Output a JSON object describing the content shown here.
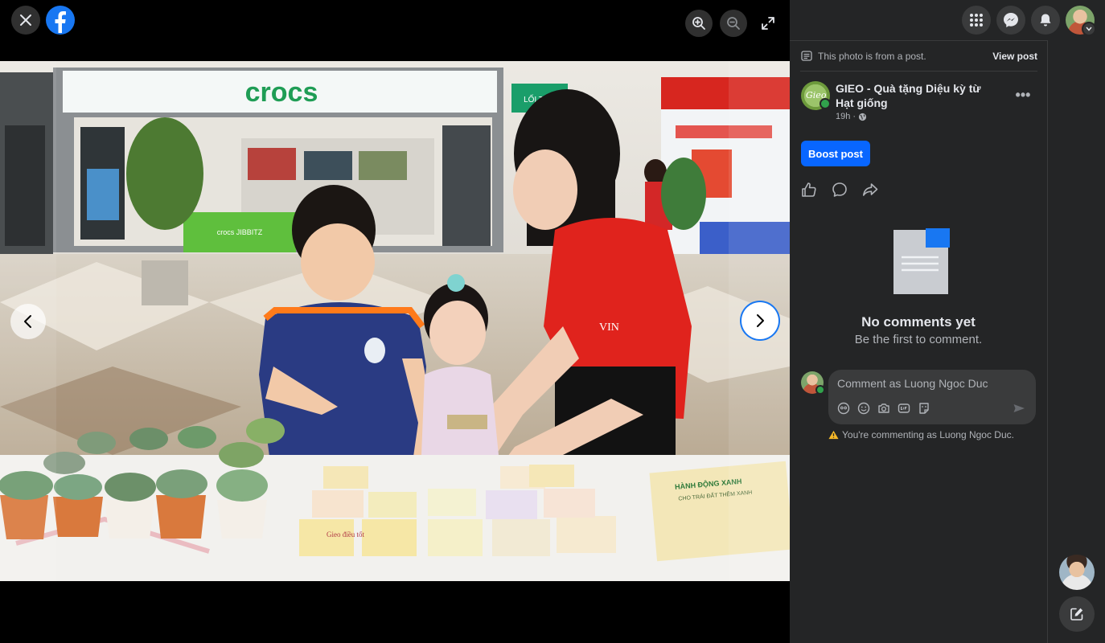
{
  "viewer": {
    "prev_label": "Previous photo",
    "next_label": "Next photo",
    "photo": {
      "store_sign": "crocs",
      "small_sign": "LỐI THO",
      "counter_sign": "crocs JIBBITZ",
      "shirt_text": "VIN",
      "poster_title": "HÀNH ĐỘNG XANH",
      "poster_sub": "CHO TRÁI ĐẤT THÊM XANH",
      "card_text": "Gieo điều tốt"
    }
  },
  "post": {
    "from_post_text": "This photo is from a post.",
    "view_post_label": "View post",
    "page_name": "GIEO - Quà tặng Diệu kỳ từ Hạt giống",
    "page_logo_text": "Gieo",
    "time": "19h",
    "more_label": "•••",
    "boost_label": "Boost post"
  },
  "comments": {
    "empty_title": "No comments yet",
    "empty_subtitle": "Be the first to comment.",
    "input_placeholder": "Comment as Luong Ngoc Duc",
    "warning_text": "You're commenting as Luong Ngoc Duc."
  },
  "colors": {
    "accent": "#0866ff",
    "panel_bg": "#242526",
    "input_bg": "#3a3b3c"
  }
}
